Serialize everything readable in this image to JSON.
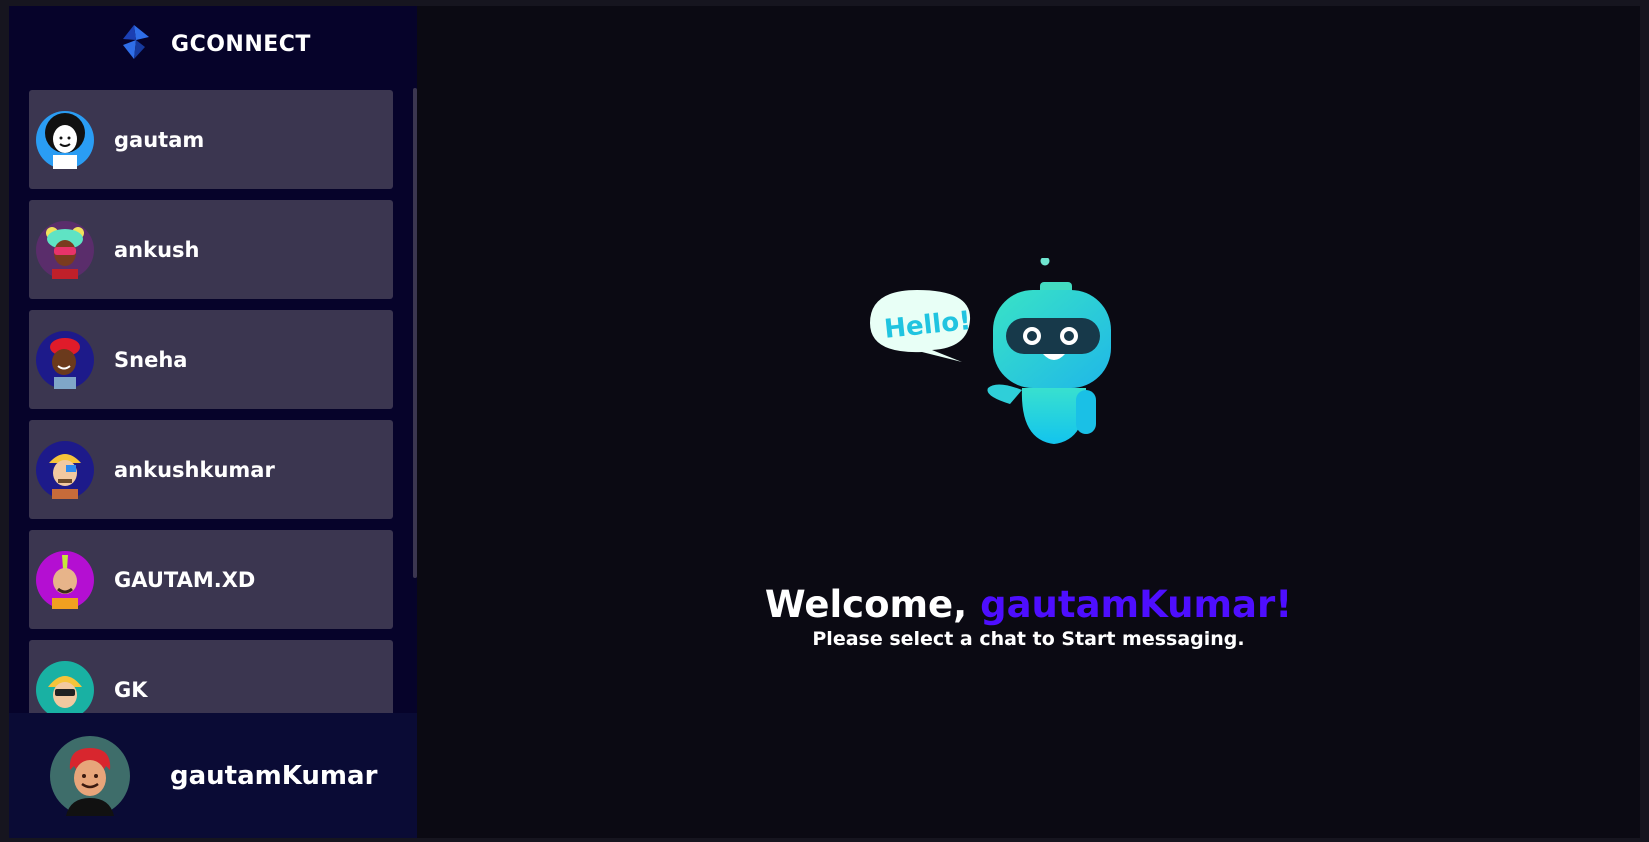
{
  "brand": {
    "title": "GCONNECT",
    "logo_icon": "gconnect-logo-icon"
  },
  "contacts": [
    {
      "name": "gautam",
      "avatar_icon": "avatar-afro-icon",
      "avatar_bg": "#2a9df4"
    },
    {
      "name": "ankush",
      "avatar_icon": "avatar-bear-hat-icon",
      "avatar_bg": "#5a2d6b"
    },
    {
      "name": "Sneha",
      "avatar_icon": "avatar-red-cap-icon",
      "avatar_bg": "#1d1a8a"
    },
    {
      "name": "ankushkumar",
      "avatar_icon": "avatar-yellow-cap-icon",
      "avatar_bg": "#1d1a8a"
    },
    {
      "name": "GAUTAM.XD",
      "avatar_icon": "avatar-mohawk-icon",
      "avatar_bg": "#b40fd2"
    },
    {
      "name": "GK",
      "avatar_icon": "avatar-helmet-icon",
      "avatar_bg": "#19b1a3"
    }
  ],
  "current_user": {
    "name": "gautamKumar",
    "avatar_icon": "avatar-red-hair-icon",
    "avatar_bg": "#3e6d6a"
  },
  "welcome": {
    "prefix": "Welcome, ",
    "username": "gautamKumar!",
    "subtitle": "Please select a chat to Start messaging.",
    "robot_icon": "hello-robot-icon",
    "bubble_text": "Hello!"
  },
  "colors": {
    "accent": "#4e0eff",
    "sidebar_bg": "#06032a",
    "contact_bg": "#3b3650",
    "main_bg": "#0b0a13"
  }
}
